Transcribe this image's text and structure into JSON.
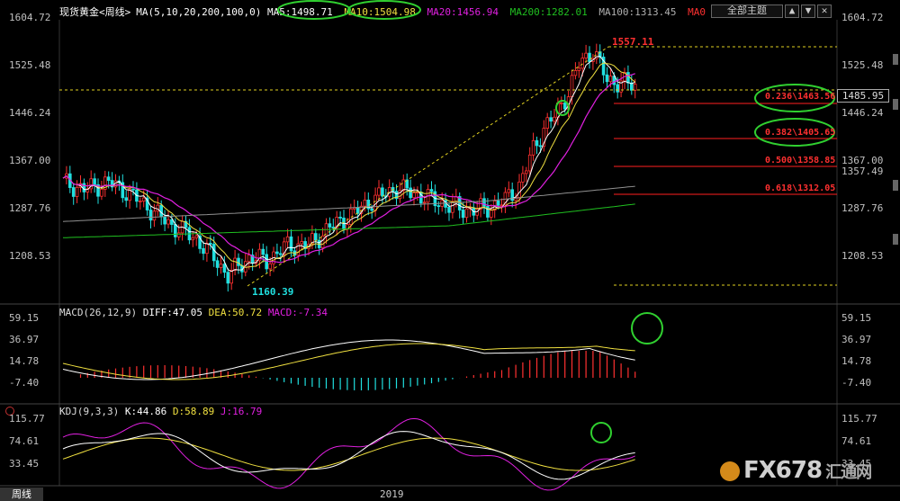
{
  "header": {
    "symbol": "现货黄金<周线>",
    "ma_params": "MA(5,10,20,200,100,0)",
    "ma5": "MA5:1498.71",
    "ma10": "MA10:1504.98",
    "ma20": "MA20:1456.94",
    "ma200": "MA200:1282.01",
    "ma100": "MA100:1313.45",
    "ma0": "MA0",
    "theme_button": "全部主题",
    "btn_up": "▲",
    "btn_down": "▼",
    "btn_close": "✕"
  },
  "price_axis_left": [
    "1604.72",
    "1525.48",
    "1446.24",
    "1367.00",
    "1287.76",
    "1208.53"
  ],
  "price_axis_right": [
    "1604.72",
    "1525.48",
    "1446.24",
    "1367.00",
    "1357.49",
    "1287.76",
    "1208.53"
  ],
  "current_price": "1485.95",
  "annotations": {
    "high": "1557.11",
    "low": "1160.39"
  },
  "fibonacci": [
    "0.236\\1463.56",
    "0.382\\1405.65",
    "0.500\\1358.85",
    "0.618\\1312.05"
  ],
  "macd": {
    "title": "MACD(26,12,9)",
    "diff": "DIFF:47.05",
    "dea": "DEA:50.72",
    "macd": "MACD:-7.34",
    "axis": [
      "59.15",
      "36.97",
      "14.78",
      "-7.40"
    ]
  },
  "kdj": {
    "title": "KDJ(9,3,3)",
    "k": "K:44.86",
    "d": "D:58.89",
    "j": "J:16.79",
    "axis": [
      "115.77",
      "74.61",
      "33.45"
    ]
  },
  "bottom": {
    "tab": "周线",
    "year": "2019",
    "logo_text": "FX678",
    "logo_cn": "汇通网"
  },
  "colors": {
    "ma5": "#ffffff",
    "ma10": "#f0e040",
    "ma20": "#e020e0",
    "ma200": "#20c020",
    "ma100": "#909090",
    "up": "#ff3030",
    "down": "#20e0e0",
    "fib": "#ff2020",
    "circle": "#30d030"
  }
}
